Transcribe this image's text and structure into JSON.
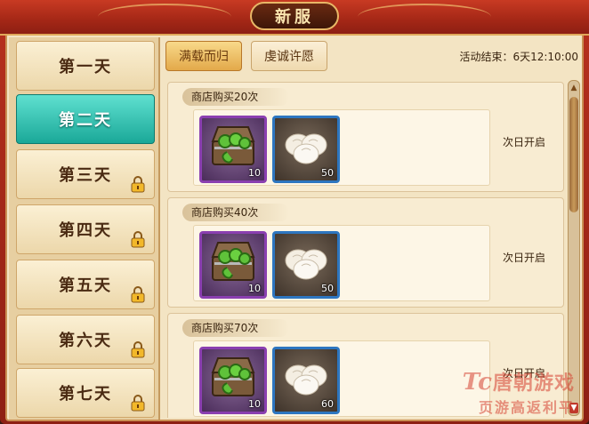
{
  "header": {
    "title": "新服"
  },
  "sidebar": {
    "days": [
      {
        "label": "第一天",
        "active": false,
        "locked": false
      },
      {
        "label": "第二天",
        "active": true,
        "locked": false
      },
      {
        "label": "第三天",
        "active": false,
        "locked": true
      },
      {
        "label": "第四天",
        "active": false,
        "locked": true
      },
      {
        "label": "第五天",
        "active": false,
        "locked": true
      },
      {
        "label": "第六天",
        "active": false,
        "locked": true
      },
      {
        "label": "第七天",
        "active": false,
        "locked": true
      }
    ]
  },
  "tabs": [
    {
      "label": "满载而归",
      "selected": true
    },
    {
      "label": "虔诚许愿",
      "selected": false
    }
  ],
  "event_end": "活动结束：6天12:10:00",
  "tasks": [
    {
      "title": "商店购买20次",
      "status": "次日开启",
      "items": [
        {
          "icon": "treasure-chest-icon",
          "count": "10"
        },
        {
          "icon": "steamed-bun-icon",
          "count": "50"
        }
      ]
    },
    {
      "title": "商店购买40次",
      "status": "次日开启",
      "items": [
        {
          "icon": "treasure-chest-icon",
          "count": "10"
        },
        {
          "icon": "steamed-bun-icon",
          "count": "50"
        }
      ]
    },
    {
      "title": "商店购买70次",
      "status": "次日开启",
      "items": [
        {
          "icon": "treasure-chest-icon",
          "count": "10"
        },
        {
          "icon": "steamed-bun-icon",
          "count": "60"
        }
      ]
    }
  ],
  "watermark": {
    "line1_prefix": "Tc",
    "line1": "唐朝游戏",
    "line2": "页游高返利平"
  },
  "colors": {
    "active_tab": "#1aa898",
    "frame_red": "#a42716",
    "purple_border": "#8a3fb0",
    "blue_border": "#2d76c0"
  }
}
